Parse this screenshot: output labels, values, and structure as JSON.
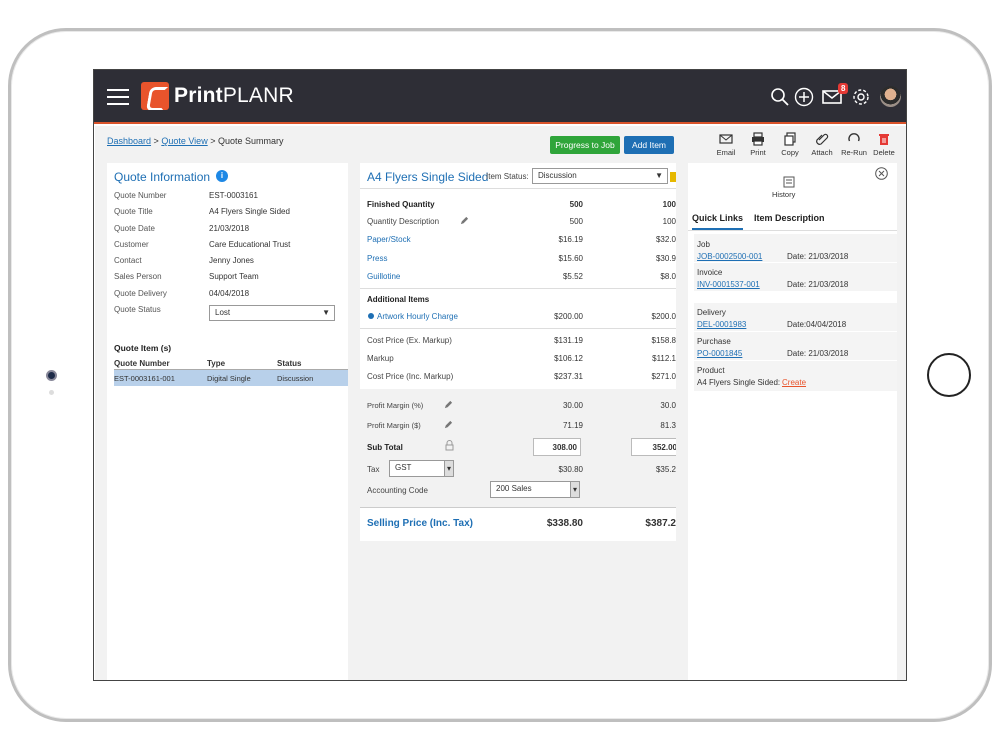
{
  "app": {
    "brand_bold": "Print",
    "brand_light": "PLANR",
    "notif_count": "8"
  },
  "breadcrumb": {
    "dashboard": "Dashboard",
    "quote_view": "Quote View",
    "current": "Quote Summary",
    "sep": ">"
  },
  "actions": {
    "progress": "Progress to Job",
    "add_item": "Add Item"
  },
  "toolbar": {
    "email": "Email",
    "print": "Print",
    "copy": "Copy",
    "attach": "Attach",
    "rerun": "Re-Run",
    "delete": "Delete"
  },
  "quote_info": {
    "title": "Quote Information",
    "fields": [
      {
        "label": "Quote Number",
        "value": "EST-0003161"
      },
      {
        "label": "Quote Title",
        "value": "A4 Flyers Single Sided"
      },
      {
        "label": "Quote Date",
        "value": "21/03/2018"
      },
      {
        "label": "Customer",
        "value": "Care Educational Trust"
      },
      {
        "label": "Contact",
        "value": "Jenny Jones"
      },
      {
        "label": "Sales Person",
        "value": "Support Team"
      },
      {
        "label": "Quote Delivery",
        "value": "04/04/2018"
      }
    ],
    "status_label": "Quote Status",
    "status_value": "Lost"
  },
  "quote_items": {
    "title": "Quote Item (s)",
    "headers": [
      "Quote Number",
      "Type",
      "Status"
    ],
    "rows": [
      {
        "number": "EST-0003161-001",
        "type": "Digital Single",
        "status": "Discussion"
      }
    ]
  },
  "item": {
    "title": "A4 Flyers Single Sided",
    "status_label": "Item Status:",
    "status_value": "Discussion",
    "finished_qty_label": "Finished Quantity",
    "qty1": "500",
    "qty2": "100",
    "qty_desc_label": "Quantity Description",
    "qty_desc1": "500",
    "qty_desc2": "100",
    "costs": [
      {
        "label": "Paper/Stock",
        "v1": "$16.19",
        "v2": "$32.0"
      },
      {
        "label": "Press",
        "v1": "$15.60",
        "v2": "$30.9"
      },
      {
        "label": "Guillotine",
        "v1": "$5.52",
        "v2": "$8.0"
      }
    ],
    "additional_label": "Additional Items",
    "artwork_label": "Artwork Hourly Charge",
    "artwork1": "$200.00",
    "artwork2": "$200.0",
    "cost_ex_label": "Cost Price (Ex. Markup)",
    "cost_ex1": "$131.19",
    "cost_ex2": "$158.8",
    "markup_label": "Markup",
    "markup1": "$106.12",
    "markup2": "$112.1",
    "cost_inc_label": "Cost Price (Inc. Markup)",
    "cost_inc1": "$237.31",
    "cost_inc2": "$271.0",
    "pm_pct_label": "Profit Margin (%)",
    "pm_pct1": "30.00",
    "pm_pct2": "30.0",
    "pm_amt_label": "Profit Margin ($)",
    "pm_amt1": "71.19",
    "pm_amt2": "81.3",
    "subtotal_label": "Sub Total",
    "subtotal1": "308.00",
    "subtotal2": "352.00",
    "tax_label": "Tax",
    "tax_value": "GST",
    "tax1": "$30.80",
    "tax2": "$35.2",
    "acct_label": "Accounting Code",
    "acct_value": "200 Sales",
    "selling_label": "Selling Price (Inc. Tax)",
    "selling1": "$338.80",
    "selling2": "$387.2"
  },
  "side": {
    "history": "History",
    "tab_links": "Quick Links",
    "tab_desc": "Item Description",
    "job_label": "Job",
    "job_link": "JOB-0002500-001",
    "job_date": "Date: 21/03/2018",
    "inv_label": "Invoice",
    "inv_link": "INV-0001537-001",
    "inv_date": "Date: 21/03/2018",
    "del_label": "Delivery",
    "del_link": "DEL-0001983",
    "del_date": "Date:04/04/2018",
    "pur_label": "Purchase",
    "pur_link": "PO-0001845",
    "pur_date": "Date: 21/03/2018",
    "prod_label": "Product",
    "prod_text": "A4 Flyers Single Sided:",
    "prod_create": "Create"
  },
  "colors": {
    "accent": "#1e6fb4",
    "green": "#2fa53a",
    "topbar": "#2e2e36",
    "brand_orange": "#e8542c",
    "delete_red": "#e53935"
  }
}
